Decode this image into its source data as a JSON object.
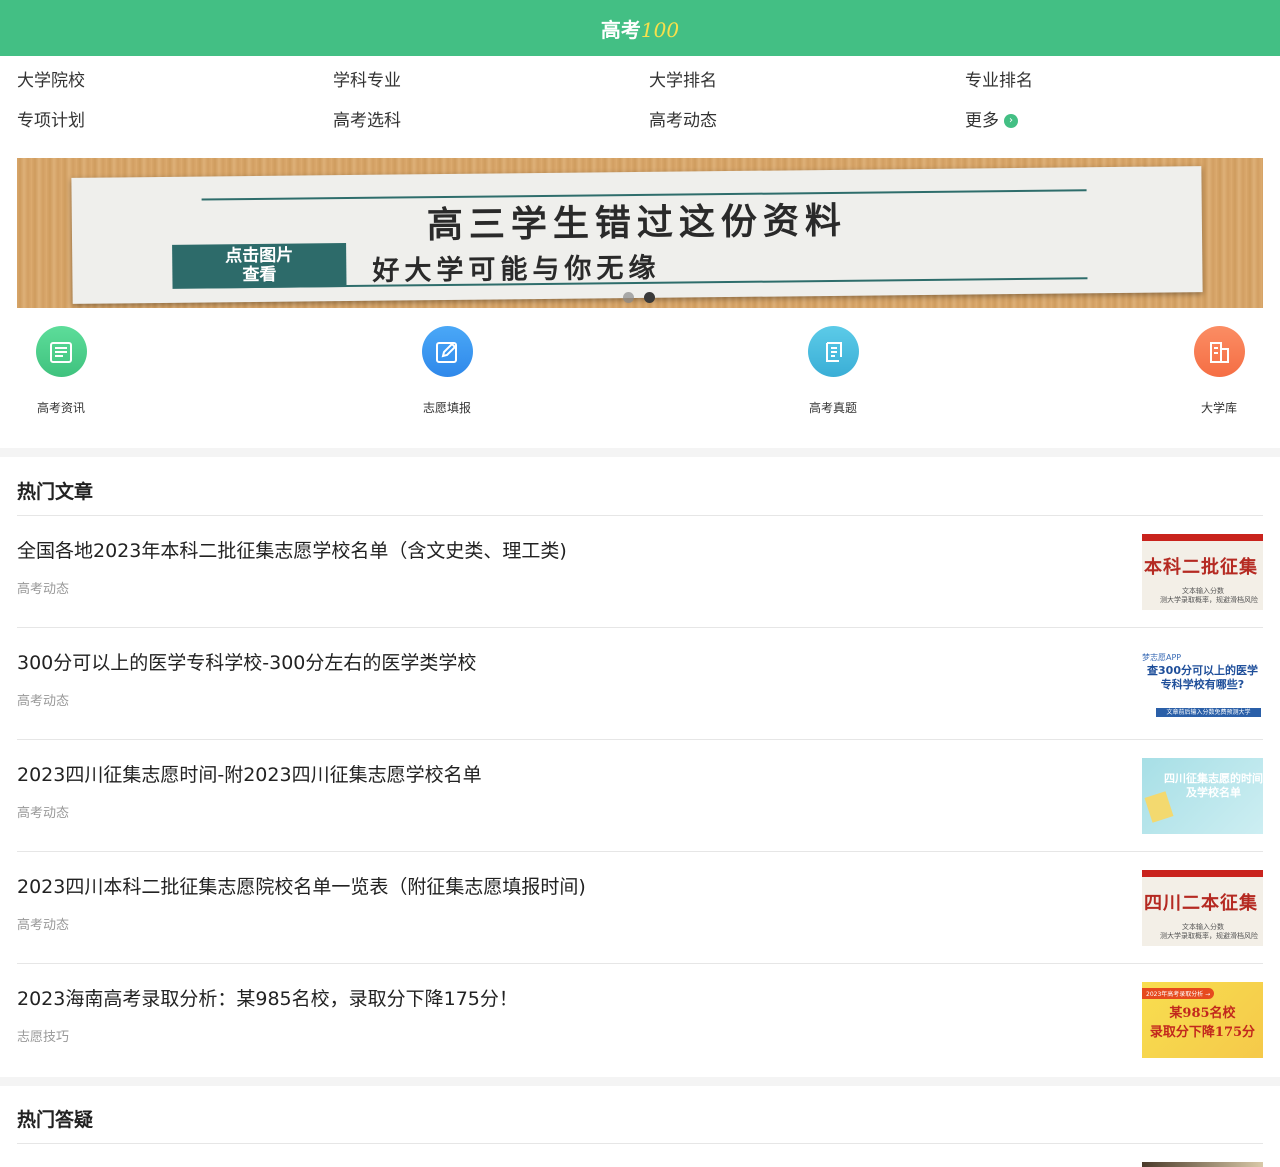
{
  "header": {
    "logo_text": "高考",
    "logo_num": "100"
  },
  "nav": {
    "items": [
      {
        "label": "大学院校"
      },
      {
        "label": "学科专业"
      },
      {
        "label": "大学排名"
      },
      {
        "label": "专业排名"
      },
      {
        "label": "专项计划"
      },
      {
        "label": "高考选科"
      },
      {
        "label": "高考动态"
      },
      {
        "label": "更多"
      }
    ],
    "more_icon": "chevron-right-icon"
  },
  "banner": {
    "title": "高三学生错过这份资料",
    "tag_line1": "点击图片",
    "tag_line2": "查看",
    "subtitle": "好大学可能与你无缘",
    "slide_count": 2,
    "active_slide": 2
  },
  "quick": [
    {
      "label": "高考资讯",
      "icon": "document-icon",
      "color": "#4fd18e"
    },
    {
      "label": "志愿填报",
      "icon": "edit-icon",
      "color": "#3a98f2"
    },
    {
      "label": "高考真题",
      "icon": "scroll-icon",
      "color": "#4bbde0"
    },
    {
      "label": "大学库",
      "icon": "building-icon",
      "color": "#f97d55"
    }
  ],
  "hot_articles": {
    "title": "热门文章",
    "items": [
      {
        "title": "全国各地2023年本科二批征集志愿学校名单（含文史类、理工类)",
        "category": "高考动态",
        "thumb": {
          "big": "本科二批征集",
          "small1": "文本输入分数",
          "small2": "测大学录取概率，规避滑档风险"
        }
      },
      {
        "title": "300分可以上的医学专科学校-300分左右的医学类学校",
        "category": "高考动态",
        "thumb": {
          "brand": "梦志愿APP",
          "q1": "查300分可以上的医学",
          "q2": "专科学校有哪些?",
          "bar": "文章前后输入分数免费预测大学"
        }
      },
      {
        "title": "2023四川征集志愿时间-附2023四川征集志愿学校名单",
        "category": "高考动态",
        "thumb": {
          "q1": "四川征集志愿的时间",
          "q2": "及学校名单"
        }
      },
      {
        "title": "2023四川本科二批征集志愿院校名单一览表（附征集志愿填报时间)",
        "category": "高考动态",
        "thumb": {
          "big": "四川二本征集",
          "small1": "文本输入分数",
          "small2": "测大学录取概率，规避滑档风险"
        }
      },
      {
        "title": "2023海南高考录取分析：某985名校，录取分下降175分！",
        "category": "志愿技巧",
        "thumb": {
          "tag": "2023年高考录取分析 →",
          "q1": "某985名校",
          "q2": "录取分下降175分"
        }
      }
    ]
  },
  "hot_qa": {
    "title": "热门答疑"
  }
}
